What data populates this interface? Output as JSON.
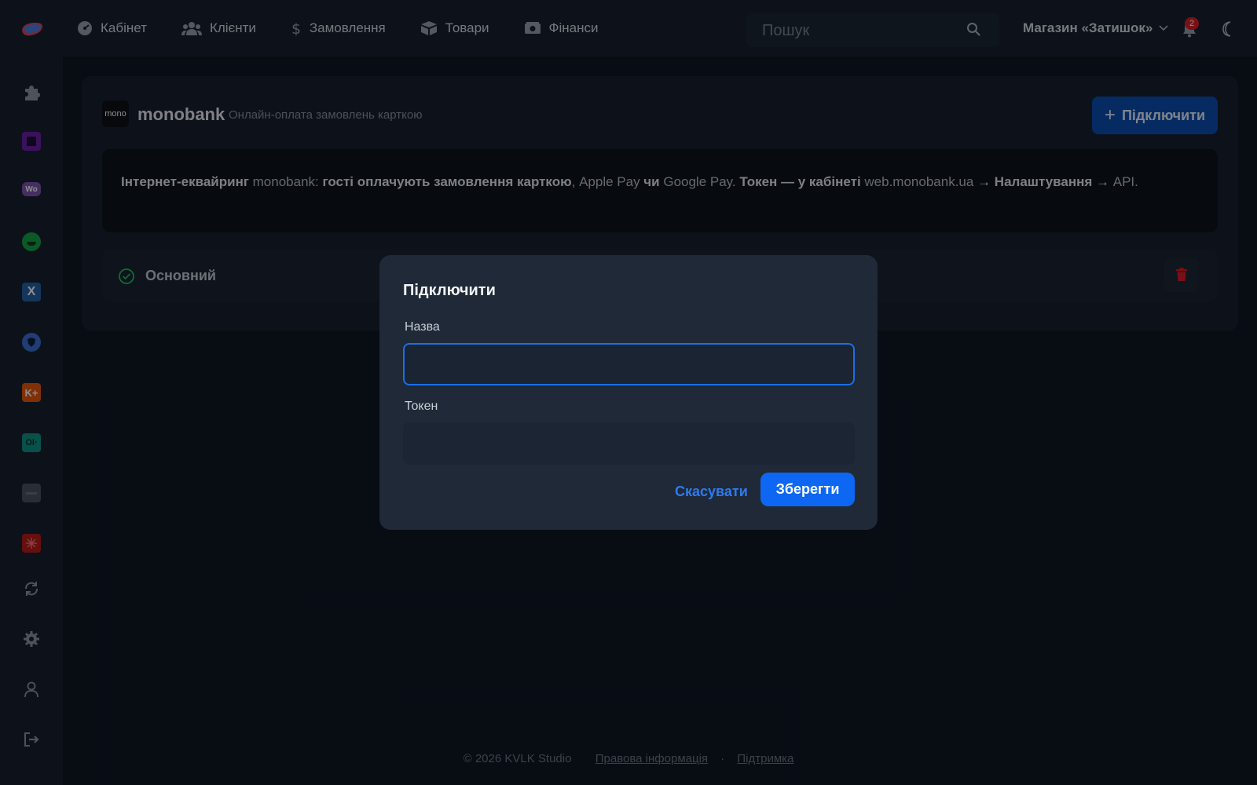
{
  "header": {
    "nav": [
      {
        "label": "Кабінет",
        "icon": "dashboard-icon"
      },
      {
        "label": "Клієнти",
        "icon": "users-icon"
      },
      {
        "label": "Замовлення",
        "icon": "dollar-icon"
      },
      {
        "label": "Товари",
        "icon": "box-icon"
      },
      {
        "label": "Фінанси",
        "icon": "money-icon"
      }
    ],
    "search_placeholder": "Пошук",
    "store_name": "Магазин «Затишок»",
    "notifications_count": "2"
  },
  "card": {
    "logo_text": "mono",
    "brand": "monobank",
    "subtitle": "Онлайн-оплата замовлень карткою",
    "connect_label": "Підключити",
    "info_parts": [
      {
        "text": "Інтернет-еквайринг",
        "bold": true
      },
      {
        "text": " monobank: ",
        "bold": false
      },
      {
        "text": "гості оплачують замовлення карткою",
        "bold": true
      },
      {
        "text": ", Apple Pay ",
        "bold": false
      },
      {
        "text": "чи",
        "bold": true
      },
      {
        "text": " Google Pay. ",
        "bold": false
      },
      {
        "text": "Токен — у кабінеті",
        "bold": true
      },
      {
        "text": " web.monobank.ua ",
        "bold": false
      },
      {
        "text": "→ Налаштування →",
        "bold": true
      },
      {
        "text": " API.",
        "bold": false
      }
    ],
    "account_name": "Основний"
  },
  "modal": {
    "title": "Підключити",
    "name_label": "Назва",
    "name_value": "",
    "token_label": "Токен",
    "token_value": "",
    "cancel_label": "Скасувати",
    "save_label": "Зберегти"
  },
  "footer": {
    "copyright": "© 2026 KVLK Studio",
    "legal": "Правова інформація",
    "separator": "·",
    "support": "Підтримка"
  },
  "colors": {
    "accent": "#0d67f2",
    "danger": "#e11d2a",
    "success": "#22c55e"
  }
}
